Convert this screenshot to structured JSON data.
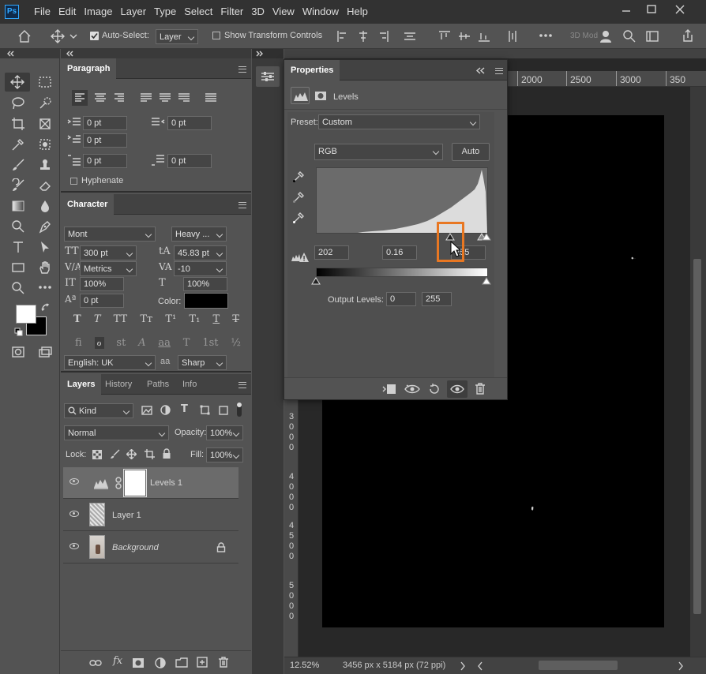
{
  "menubar": {
    "app_logo": "Ps",
    "items": [
      "File",
      "Edit",
      "Image",
      "Layer",
      "Type",
      "Select",
      "Filter",
      "3D",
      "View",
      "Window",
      "Help"
    ]
  },
  "options_bar": {
    "auto_select_label": "Auto-Select:",
    "auto_select_value": "Layer",
    "show_transform_label": "Show Transform Controls",
    "mode_3d_label": "3D Mod"
  },
  "ruler": {
    "ticks": [
      "2000",
      "2500",
      "3000",
      "350"
    ]
  },
  "paragraph": {
    "tab": "Paragraph",
    "indent_left": "0 pt",
    "indent_right": "0 pt",
    "indent_first": "0 pt",
    "space_before": "0 pt",
    "space_after": "0 pt",
    "hyphenate": "Hyphenate"
  },
  "character": {
    "tab": "Character",
    "font_family": "Mont",
    "font_style": "Heavy ...",
    "font_size": "300 pt",
    "leading": "45.83 pt",
    "kerning": "Metrics",
    "tracking": "-10",
    "vscale": "100%",
    "hscale": "100%",
    "baseline": "0 pt",
    "color_label": "Color:",
    "language": "English: UK",
    "aa_label": "aa",
    "antialias": "Sharp",
    "style_buttons": [
      "T",
      "T",
      "TT",
      "Tт",
      "T¹",
      "T₁",
      "T",
      "T"
    ],
    "ot_buttons": [
      "fi",
      "ℴ",
      "st",
      "A",
      "aa",
      "T",
      "1st",
      "½"
    ]
  },
  "layers": {
    "tabs": [
      "Layers",
      "History",
      "Paths",
      "Info"
    ],
    "filter_kind": "Kind",
    "blend_mode": "Normal",
    "opacity_label": "Opacity:",
    "opacity": "100%",
    "lock_label": "Lock:",
    "fill_label": "Fill:",
    "fill": "100%",
    "items": [
      {
        "name": "Levels 1",
        "selected": true
      },
      {
        "name": "Layer 1",
        "selected": false
      },
      {
        "name": "Background",
        "selected": false,
        "italic": true,
        "locked": true
      }
    ]
  },
  "properties": {
    "title": "Properties",
    "adjustment": "Levels",
    "preset_label": "Preset:",
    "preset": "Custom",
    "channel": "RGB",
    "auto": "Auto",
    "input_black": "202",
    "input_gamma": "0.16",
    "input_white": "255",
    "output_label": "Output Levels:",
    "output_black": "0",
    "output_white": "255"
  },
  "vertical_ruler": {
    "ticks": [
      "3",
      "0",
      "0",
      "0",
      "4",
      "0",
      "0",
      "0",
      "4",
      "5",
      "0",
      "0",
      "5",
      "0",
      "0",
      "0"
    ]
  },
  "status": {
    "zoom": "12.52%",
    "doc_info": "3456 px x 5184 px (72 ppi)"
  },
  "colors": {
    "highlight": "#e87722",
    "panel": "#535353",
    "app_bg": "#323232",
    "canvas_bg": "#282828"
  }
}
